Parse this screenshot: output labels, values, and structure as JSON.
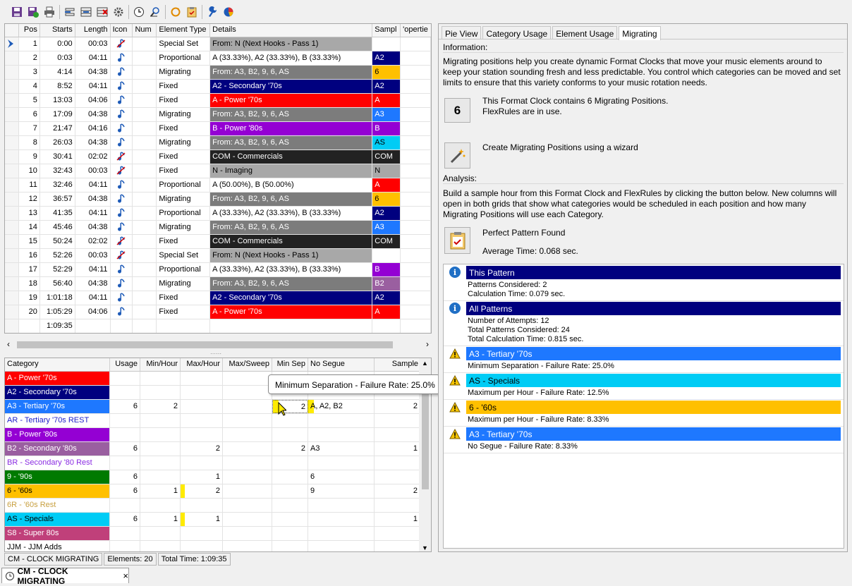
{
  "toolbar": {
    "icons": [
      "save-icon",
      "save-as-icon",
      "print-icon",
      "insert-icon",
      "edit-icon",
      "delete-icon",
      "gear-icon",
      "clock-icon",
      "search-icon",
      "refresh-icon",
      "clipboard-icon",
      "wrench-icon",
      "pie-icon"
    ]
  },
  "top_grid": {
    "columns": [
      "Pos",
      "Starts",
      "Length",
      "Icon",
      "Num",
      "Element Type",
      "Details",
      "Sampl",
      "'opertie"
    ],
    "rows": [
      {
        "pos": "1",
        "starts": "0:00",
        "length": "00:03",
        "type": "Special Set",
        "details": "From: N (Next Hooks - Pass 1)",
        "detail_bg": "#a8a8a8",
        "detail_fg": "#000000",
        "sample": "",
        "sample_bg": "#ffffff",
        "sample_fg": "#000000",
        "icon": "muted"
      },
      {
        "pos": "2",
        "starts": "0:03",
        "length": "04:11",
        "type": "Proportional",
        "details": "A (33.33%), A2 (33.33%), B (33.33%)",
        "detail_bg": "#ffffff",
        "detail_fg": "#000000",
        "sample": "A2",
        "sample_bg": "#00007f",
        "sample_fg": "#ffffff",
        "icon": "note"
      },
      {
        "pos": "3",
        "starts": "4:14",
        "length": "04:38",
        "type": "Migrating",
        "details": "From: A3, B2, 9, 6, AS",
        "detail_bg": "#7c7c7c",
        "detail_fg": "#ffffff",
        "sample": "6",
        "sample_bg": "#ffc000",
        "sample_fg": "#000000",
        "icon": "note"
      },
      {
        "pos": "4",
        "starts": "8:52",
        "length": "04:11",
        "type": "Fixed",
        "details": "A2 - Secondary '70s",
        "detail_bg": "#00007f",
        "detail_fg": "#ffffff",
        "sample": "A2",
        "sample_bg": "#00007f",
        "sample_fg": "#ffffff",
        "icon": "note"
      },
      {
        "pos": "5",
        "starts": "13:03",
        "length": "04:06",
        "type": "Fixed",
        "details": "A - Power '70s",
        "detail_bg": "#ff0000",
        "detail_fg": "#ffffff",
        "sample": "A",
        "sample_bg": "#ff0000",
        "sample_fg": "#ffffff",
        "icon": "note"
      },
      {
        "pos": "6",
        "starts": "17:09",
        "length": "04:38",
        "type": "Migrating",
        "details": "From: A3, B2, 9, 6, AS",
        "detail_bg": "#7c7c7c",
        "detail_fg": "#ffffff",
        "sample": "A3",
        "sample_bg": "#1e78ff",
        "sample_fg": "#ffffff",
        "icon": "note"
      },
      {
        "pos": "7",
        "starts": "21:47",
        "length": "04:16",
        "type": "Fixed",
        "details": "B - Power '80s",
        "detail_bg": "#9400d3",
        "detail_fg": "#ffffff",
        "sample": "B",
        "sample_bg": "#9400d3",
        "sample_fg": "#ffffff",
        "icon": "note"
      },
      {
        "pos": "8",
        "starts": "26:03",
        "length": "04:38",
        "type": "Migrating",
        "details": "From: A3, B2, 9, 6, AS",
        "detail_bg": "#7c7c7c",
        "detail_fg": "#ffffff",
        "sample": "AS",
        "sample_bg": "#00ccf5",
        "sample_fg": "#000000",
        "icon": "note"
      },
      {
        "pos": "9",
        "starts": "30:41",
        "length": "02:02",
        "type": "Fixed",
        "details": "COM - Commercials",
        "detail_bg": "#222222",
        "detail_fg": "#ffffff",
        "sample": "COM",
        "sample_bg": "#222222",
        "sample_fg": "#ffffff",
        "icon": "muted"
      },
      {
        "pos": "10",
        "starts": "32:43",
        "length": "00:03",
        "type": "Fixed",
        "details": "N - Imaging",
        "detail_bg": "#a8a8a8",
        "detail_fg": "#000000",
        "sample": "N",
        "sample_bg": "#a8a8a8",
        "sample_fg": "#000000",
        "icon": "muted"
      },
      {
        "pos": "11",
        "starts": "32:46",
        "length": "04:11",
        "type": "Proportional",
        "details": "A (50.00%), B (50.00%)",
        "detail_bg": "#ffffff",
        "detail_fg": "#000000",
        "sample": "A",
        "sample_bg": "#ff0000",
        "sample_fg": "#ffffff",
        "icon": "note"
      },
      {
        "pos": "12",
        "starts": "36:57",
        "length": "04:38",
        "type": "Migrating",
        "details": "From: A3, B2, 9, 6, AS",
        "detail_bg": "#7c7c7c",
        "detail_fg": "#ffffff",
        "sample": "6",
        "sample_bg": "#ffc000",
        "sample_fg": "#000000",
        "icon": "note"
      },
      {
        "pos": "13",
        "starts": "41:35",
        "length": "04:11",
        "type": "Proportional",
        "details": "A (33.33%), A2 (33.33%), B (33.33%)",
        "detail_bg": "#ffffff",
        "detail_fg": "#000000",
        "sample": "A2",
        "sample_bg": "#00007f",
        "sample_fg": "#ffffff",
        "icon": "note"
      },
      {
        "pos": "14",
        "starts": "45:46",
        "length": "04:38",
        "type": "Migrating",
        "details": "From: A3, B2, 9, 6, AS",
        "detail_bg": "#7c7c7c",
        "detail_fg": "#ffffff",
        "sample": "A3",
        "sample_bg": "#1e78ff",
        "sample_fg": "#ffffff",
        "icon": "note"
      },
      {
        "pos": "15",
        "starts": "50:24",
        "length": "02:02",
        "type": "Fixed",
        "details": "COM - Commercials",
        "detail_bg": "#222222",
        "detail_fg": "#ffffff",
        "sample": "COM",
        "sample_bg": "#222222",
        "sample_fg": "#ffffff",
        "icon": "muted"
      },
      {
        "pos": "16",
        "starts": "52:26",
        "length": "00:03",
        "type": "Special Set",
        "details": "From: N (Next Hooks - Pass 1)",
        "detail_bg": "#a8a8a8",
        "detail_fg": "#000000",
        "sample": "",
        "sample_bg": "#ffffff",
        "sample_fg": "#000000",
        "icon": "muted"
      },
      {
        "pos": "17",
        "starts": "52:29",
        "length": "04:11",
        "type": "Proportional",
        "details": "A (33.33%), A2 (33.33%), B (33.33%)",
        "detail_bg": "#ffffff",
        "detail_fg": "#000000",
        "sample": "B",
        "sample_bg": "#9400d3",
        "sample_fg": "#ffffff",
        "icon": "note"
      },
      {
        "pos": "18",
        "starts": "56:40",
        "length": "04:38",
        "type": "Migrating",
        "details": "From: A3, B2, 9, 6, AS",
        "detail_bg": "#7c7c7c",
        "detail_fg": "#ffffff",
        "sample": "B2",
        "sample_bg": "#9a5fa0",
        "sample_fg": "#ffffff",
        "icon": "note"
      },
      {
        "pos": "19",
        "starts": "1:01:18",
        "length": "04:11",
        "type": "Fixed",
        "details": "A2 - Secondary '70s",
        "detail_bg": "#00007f",
        "detail_fg": "#ffffff",
        "sample": "A2",
        "sample_bg": "#00007f",
        "sample_fg": "#ffffff",
        "icon": "note"
      },
      {
        "pos": "20",
        "starts": "1:05:29",
        "length": "04:06",
        "type": "Fixed",
        "details": "A - Power '70s",
        "detail_bg": "#ff0000",
        "detail_fg": "#ffffff",
        "sample": "A",
        "sample_bg": "#ff0000",
        "sample_fg": "#ffffff",
        "icon": "note"
      }
    ],
    "total_starts": "1:09:35"
  },
  "bottom_grid": {
    "columns": [
      "Category",
      "Usage",
      "Min/Hour",
      "Max/Hour",
      "Max/Sweep",
      "Min Sep",
      "No Segue",
      "Sample"
    ],
    "rows": [
      {
        "category": "A - Power '70s",
        "bg": "#ff0000",
        "fg": "#ffffff",
        "usage": "",
        "minhour": "",
        "maxhour": "",
        "maxsweep": "",
        "minsep": "",
        "nosegue": "",
        "sample": ""
      },
      {
        "category": "A2 - Secondary '70s",
        "bg": "#00007f",
        "fg": "#ffffff",
        "usage": "",
        "minhour": "",
        "maxhour": "",
        "maxsweep": "",
        "minsep": "",
        "nosegue": "",
        "sample": ""
      },
      {
        "category": "A3 - Tertiary '70s",
        "bg": "#1e78ff",
        "fg": "#ffffff",
        "usage": "6",
        "minhour": "2",
        "maxhour": "",
        "maxsweep": "",
        "minsep": "2",
        "nosegue": "A, A2, B2",
        "sample": "2"
      },
      {
        "category": "AR - Tertiary '70s REST",
        "bg": "#ffffff",
        "fg": "#2020c8",
        "usage": "",
        "minhour": "",
        "maxhour": "",
        "maxsweep": "",
        "minsep": "",
        "nosegue": "",
        "sample": ""
      },
      {
        "category": "B - Power '80s",
        "bg": "#9400d3",
        "fg": "#ffffff",
        "usage": "",
        "minhour": "",
        "maxhour": "",
        "maxsweep": "",
        "minsep": "",
        "nosegue": "",
        "sample": ""
      },
      {
        "category": "B2 - Secondary '80s",
        "bg": "#9a5fa0",
        "fg": "#ffffff",
        "usage": "6",
        "minhour": "",
        "maxhour": "2",
        "maxsweep": "",
        "minsep": "2",
        "nosegue": "A3",
        "sample": "1"
      },
      {
        "category": "BR - Secondary '80 Rest",
        "bg": "#ffffff",
        "fg": "#8a2be2",
        "usage": "",
        "minhour": "",
        "maxhour": "",
        "maxsweep": "",
        "minsep": "",
        "nosegue": "",
        "sample": ""
      },
      {
        "category": "9 - '90s",
        "bg": "#007a00",
        "fg": "#ffffff",
        "usage": "6",
        "minhour": "",
        "maxhour": "1",
        "maxsweep": "",
        "minsep": "",
        "nosegue": "6",
        "sample": ""
      },
      {
        "category": "6 - '60s",
        "bg": "#ffc000",
        "fg": "#000000",
        "usage": "6",
        "minhour": "1",
        "maxhour": "2",
        "maxsweep": "",
        "minsep": "",
        "nosegue": "9",
        "sample": "2"
      },
      {
        "category": "6R - '60s Rest",
        "bg": "#ffffff",
        "fg": "#c8a040",
        "usage": "",
        "minhour": "",
        "maxhour": "",
        "maxsweep": "",
        "minsep": "",
        "nosegue": "",
        "sample": ""
      },
      {
        "category": "AS - Specials",
        "bg": "#00ccf5",
        "fg": "#000000",
        "usage": "6",
        "minhour": "1",
        "maxhour": "1",
        "maxsweep": "",
        "minsep": "",
        "nosegue": "",
        "sample": "1"
      },
      {
        "category": "S8 - Super 80s",
        "bg": "#c0407a",
        "fg": "#ffffff",
        "usage": "",
        "minhour": "",
        "maxhour": "",
        "maxsweep": "",
        "minsep": "",
        "nosegue": "",
        "sample": ""
      },
      {
        "category": "JJM - JJM Adds",
        "bg": "#ffffff",
        "fg": "#000000",
        "usage": "",
        "minhour": "",
        "maxhour": "",
        "maxsweep": "",
        "minsep": "",
        "nosegue": "",
        "sample": ""
      }
    ]
  },
  "tooltip": "Minimum Separation - Failure Rate: 25.0%",
  "status": {
    "clock": "CM - CLOCK MIGRATING",
    "elements": "Elements: 20",
    "total_time": "Total Time: 1:09:35"
  },
  "doc_tab": {
    "label": "CM - CLOCK MIGRATING",
    "close": "×"
  },
  "right": {
    "tabs": [
      "Pie View",
      "Category Usage",
      "Element Usage",
      "Migrating"
    ],
    "info_header": "Information:",
    "info_text": "Migrating positions help you create dynamic Format Clocks that move your music elements around to keep your station sounding fresh and less predictable. You control which categories can be moved and set limits to ensure that this variety conforms to your music rotation needs.",
    "count_badge": "6",
    "count_text1": "This Format Clock contains 6 Migrating Positions.",
    "count_text2": "FlexRules are in use.",
    "wizard_text": "Create Migrating Positions using a wizard",
    "analysis_header": "Analysis:",
    "analysis_text": "Build a sample hour from this Format Clock and FlexRules by clicking the button below. New columns will open in both grids that show what categories would be scheduled in each position and how many Migrating Positions will use each Category.",
    "pattern_title": "Perfect Pattern Found",
    "pattern_time": "Average Time: 0.068 sec.",
    "analysis_items": [
      {
        "kind": "info",
        "title": "This Pattern",
        "bg": "#00007f",
        "fg": "#ffffff",
        "lines": [
          "Patterns Considered: 2",
          "Calculation Time: 0.079 sec."
        ]
      },
      {
        "kind": "info",
        "title": "All Patterns",
        "bg": "#00007f",
        "fg": "#ffffff",
        "lines": [
          "Number of Attempts: 12",
          "Total Patterns Considered: 24",
          "Total Calculation Time: 0.815 sec."
        ]
      },
      {
        "kind": "warn",
        "title": "A3 - Tertiary '70s",
        "bg": "#1e78ff",
        "fg": "#ffffff",
        "lines": [
          "Minimum Separation - Failure Rate: 25.0%"
        ]
      },
      {
        "kind": "warn",
        "title": "AS - Specials",
        "bg": "#00ccf5",
        "fg": "#000000",
        "lines": [
          "Maximum per Hour - Failure Rate: 12.5%"
        ]
      },
      {
        "kind": "warn",
        "title": "6 - '60s",
        "bg": "#ffc000",
        "fg": "#000000",
        "lines": [
          "Maximum per Hour - Failure Rate: 8.33%"
        ]
      },
      {
        "kind": "warn",
        "title": "A3 - Tertiary '70s",
        "bg": "#1e78ff",
        "fg": "#ffffff",
        "lines": [
          "No Segue - Failure Rate: 8.33%"
        ]
      }
    ]
  }
}
